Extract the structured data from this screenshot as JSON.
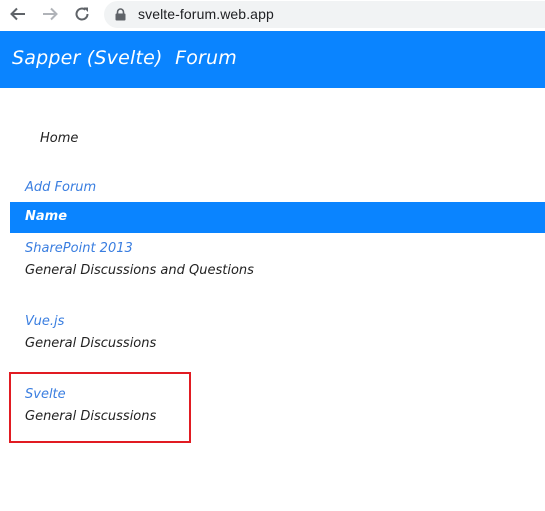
{
  "browser": {
    "url": "svelte-forum.web.app"
  },
  "app": {
    "title": "Sapper (Svelte)  Forum"
  },
  "nav": {
    "home": "Home",
    "add_forum": "Add Forum"
  },
  "table": {
    "column_name": "Name"
  },
  "forums": [
    {
      "name": "SharePoint 2013",
      "description": "General Discussions and Questions"
    },
    {
      "name": "Vue.js",
      "description": "General Discussions"
    },
    {
      "name": "Svelte",
      "description": "General Discussions"
    }
  ],
  "colors": {
    "header_blue": "#0a84ff",
    "link_blue": "#3a7ee0",
    "highlight_red": "#e11b22"
  }
}
